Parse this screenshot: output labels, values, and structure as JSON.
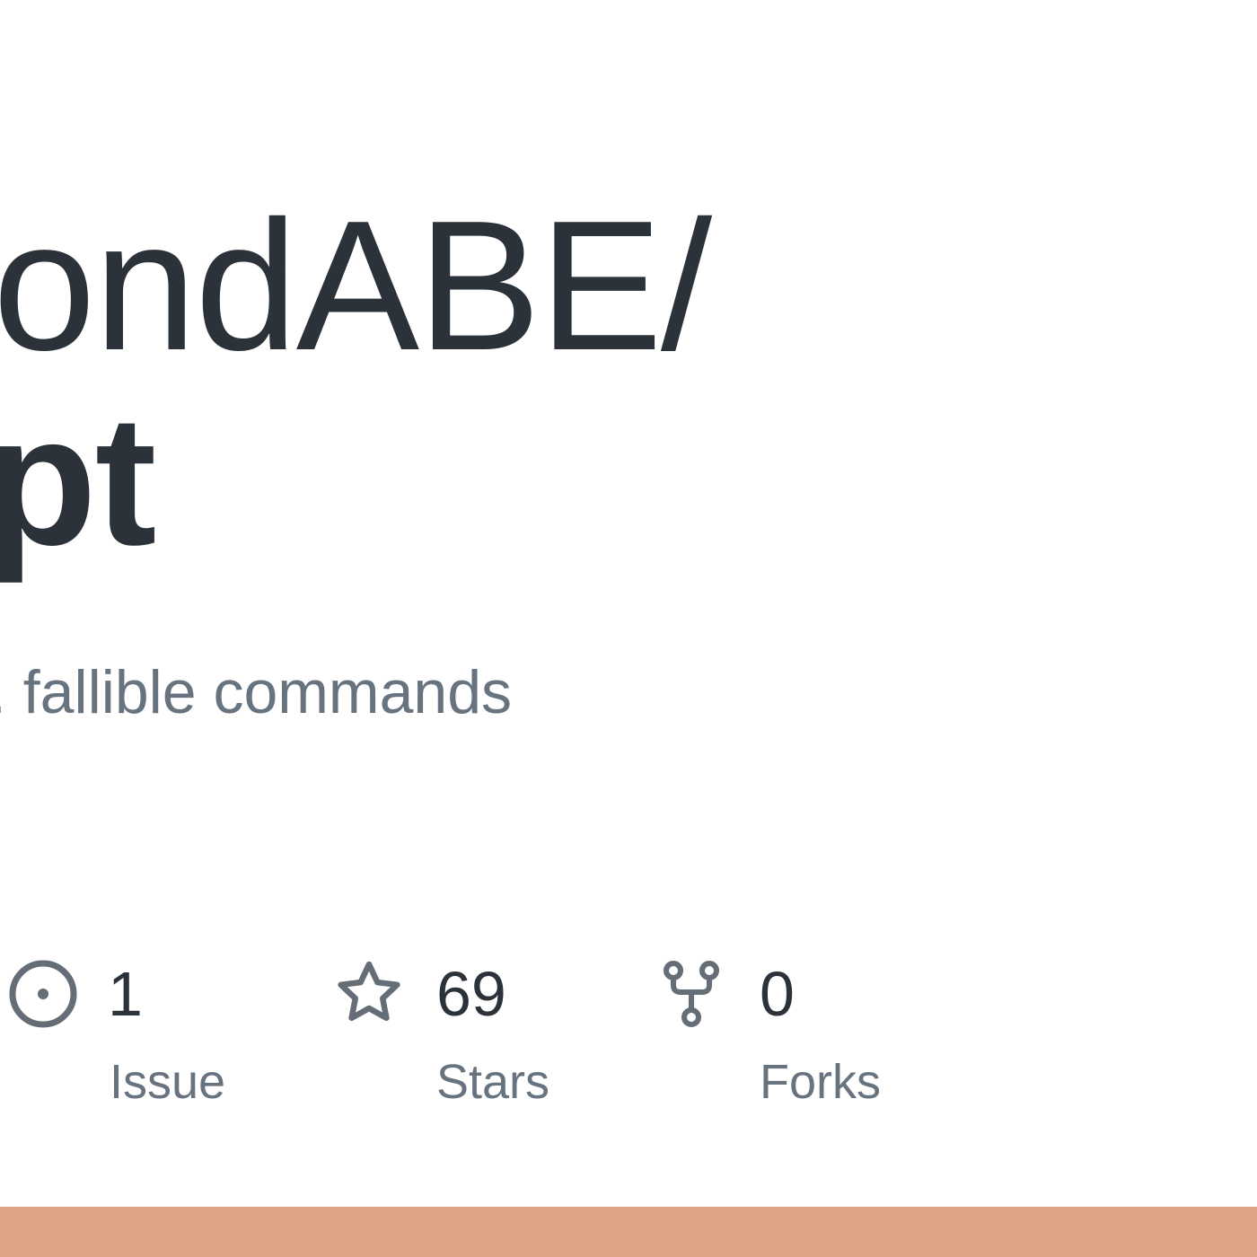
{
  "header": {
    "owner_fragment": "ondABE/",
    "repo_fragment": "pt"
  },
  "description": {
    "text_fragment": ". fallible commands"
  },
  "stats": [
    {
      "icon": "issue-opened-icon",
      "value": "1",
      "label": "Issue"
    },
    {
      "icon": "star-icon",
      "value": "69",
      "label": "Stars"
    },
    {
      "icon": "repo-forked-icon",
      "value": "0",
      "label": "Forks"
    }
  ],
  "colors": {
    "text_primary": "#2b323a",
    "text_muted": "#687380",
    "icon": "#656d76",
    "language_bar": "#dea584",
    "background": "#ffffff"
  }
}
